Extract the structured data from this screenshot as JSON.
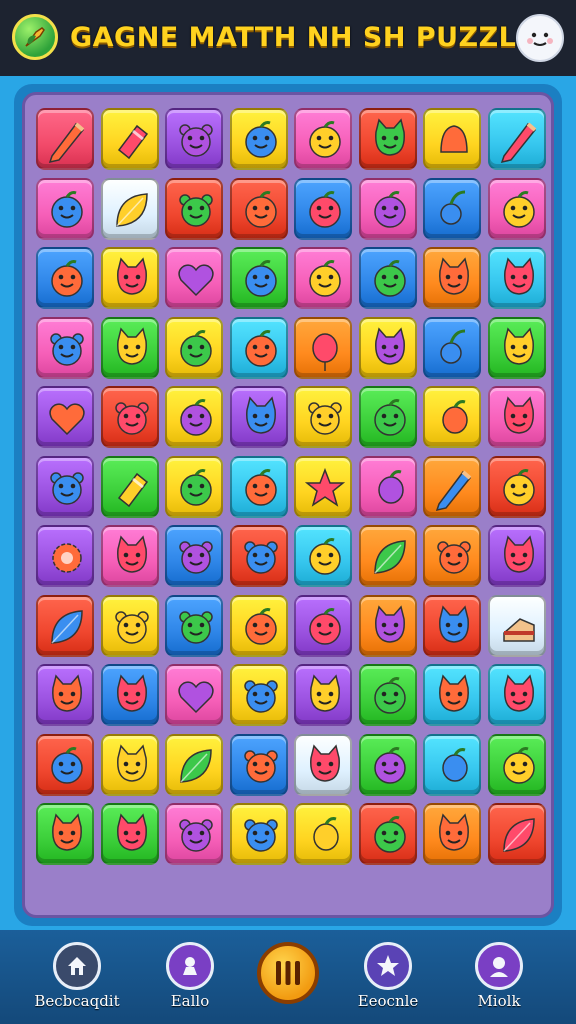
{
  "header": {
    "title": "GAGNE MATTH NH SH PUZZLE",
    "logo_icon": "leaf-pencil-icon",
    "profile_icon": "smiley-face-icon"
  },
  "board": {
    "rows": 12,
    "cols": 8,
    "tiles": [
      [
        "pink-red",
        "pencil-icon"
      ],
      [
        "yellow",
        "eraser-icon"
      ],
      [
        "purple",
        "bear-icon"
      ],
      [
        "yellow",
        "apple-icon"
      ],
      [
        "pink",
        "apple-icon"
      ],
      [
        "red",
        "cat-icon"
      ],
      [
        "yellow",
        "bell-icon"
      ],
      [
        "cyan",
        "pencil-icon"
      ],
      [
        "pink",
        "apple-icon"
      ],
      [
        "light",
        "leaf-icon"
      ],
      [
        "red",
        "bear-icon"
      ],
      [
        "red",
        "apple-icon"
      ],
      [
        "blue",
        "apple-icon"
      ],
      [
        "pink",
        "apple-icon"
      ],
      [
        "blue",
        "cherry-icon"
      ],
      [
        "pink",
        "apple-icon"
      ],
      [
        "blue",
        "apple-icon"
      ],
      [
        "yellow",
        "cat-icon"
      ],
      [
        "pink",
        "heart-icon"
      ],
      [
        "green",
        "apple-icon"
      ],
      [
        "pink",
        "apple-icon"
      ],
      [
        "blue",
        "apple-icon"
      ],
      [
        "orange",
        "cat-icon"
      ],
      [
        "cyan",
        "cat-icon"
      ],
      [
        "pink",
        "bear-icon"
      ],
      [
        "green",
        "cat-icon"
      ],
      [
        "yellow",
        "apple-icon"
      ],
      [
        "cyan",
        "apple-icon"
      ],
      [
        "orange",
        "balloon-icon"
      ],
      [
        "yellow",
        "cat-icon"
      ],
      [
        "blue",
        "cherry-icon"
      ],
      [
        "green",
        "cat-icon"
      ],
      [
        "purple",
        "heart-icon"
      ],
      [
        "red",
        "bear-icon"
      ],
      [
        "yellow",
        "apple-icon"
      ],
      [
        "purple",
        "cat-icon"
      ],
      [
        "yellow",
        "bear-icon"
      ],
      [
        "green",
        "apple-icon"
      ],
      [
        "yellow",
        "grape-icon"
      ],
      [
        "pink",
        "cat-icon"
      ],
      [
        "purple",
        "bear-icon"
      ],
      [
        "green",
        "eraser-icon"
      ],
      [
        "yellow",
        "apple-icon"
      ],
      [
        "cyan",
        "apple-icon"
      ],
      [
        "yellow",
        "star-icon"
      ],
      [
        "pink",
        "grape-icon"
      ],
      [
        "orange",
        "pencil-icon"
      ],
      [
        "red",
        "apple-icon"
      ],
      [
        "purple",
        "flower-icon"
      ],
      [
        "pink",
        "cat-icon"
      ],
      [
        "blue",
        "bear-icon"
      ],
      [
        "red",
        "bear-icon"
      ],
      [
        "cyan",
        "apple-icon"
      ],
      [
        "orange",
        "leaf-icon"
      ],
      [
        "orange",
        "bear-icon"
      ],
      [
        "purple",
        "cat-icon"
      ],
      [
        "red",
        "leaf-icon"
      ],
      [
        "yellow",
        "bear-icon"
      ],
      [
        "blue",
        "bear-icon"
      ],
      [
        "yellow",
        "apple-icon"
      ],
      [
        "purple",
        "apple-icon"
      ],
      [
        "orange",
        "cat-icon"
      ],
      [
        "red",
        "cat-icon"
      ],
      [
        "light",
        "cake-icon"
      ],
      [
        "purple",
        "cat-icon"
      ],
      [
        "blue",
        "cat-icon"
      ],
      [
        "pink",
        "heart-icon"
      ],
      [
        "yellow",
        "bear-icon"
      ],
      [
        "purple",
        "cat-icon"
      ],
      [
        "green",
        "apple-icon"
      ],
      [
        "cyan",
        "cat-icon"
      ],
      [
        "cyan",
        "cat-icon"
      ],
      [
        "red",
        "apple-icon"
      ],
      [
        "yellow",
        "cat-icon"
      ],
      [
        "yellow",
        "leaf-icon"
      ],
      [
        "blue",
        "bear-icon"
      ],
      [
        "light",
        "cat-icon"
      ],
      [
        "green",
        "apple-icon"
      ],
      [
        "cyan",
        "grape-icon"
      ],
      [
        "green",
        "apple-icon"
      ],
      [
        "green",
        "cat-icon"
      ],
      [
        "green",
        "cat-icon"
      ],
      [
        "pink",
        "bear-icon"
      ],
      [
        "yellow",
        "bear-icon"
      ],
      [
        "yellow",
        "grape-icon"
      ],
      [
        "red",
        "apple-icon"
      ],
      [
        "orange",
        "cat-icon"
      ],
      [
        "red",
        "leaf-icon"
      ]
    ]
  },
  "nav": {
    "items": [
      {
        "label": "Becbcaqdit",
        "icon": "home-icon",
        "color": "#3a4a6b"
      },
      {
        "label": "Eallo",
        "icon": "game-piece-icon",
        "color": "#7a3fc4"
      },
      {
        "label": "Eeocnle",
        "icon": "star-icon",
        "color": "#5a43b5"
      },
      {
        "label": "Miolk",
        "icon": "user-icon",
        "color": "#7a3fc4"
      }
    ],
    "pause_icon": "pause-icon"
  },
  "palette": {
    "red": "#f0472f",
    "pink-red": "#f24a6a",
    "pink": "#f65fb8",
    "purple": "#9b52e0",
    "blue": "#2f86e8",
    "cyan": "#36c6ee",
    "green": "#3ccf3a",
    "yellow": "#ffd420",
    "orange": "#ff8a1e",
    "light": "#dff1ff"
  }
}
